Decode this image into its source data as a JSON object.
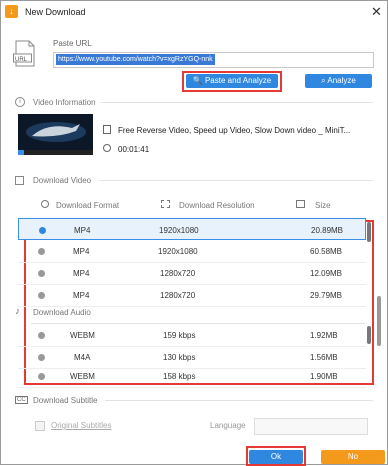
{
  "window": {
    "title": "New Download",
    "app_icon_glyph": "↓"
  },
  "paste": {
    "label": "Paste URL",
    "url_icon_text": "URL",
    "url_value": "https://www.youtube.com/watch?v=xgRzYGQ-nnk",
    "paste_analyze_label": "Paste and Analyze",
    "analyze_label": "Analyze"
  },
  "video_info": {
    "section_title": "Video Information",
    "title": "Free Reverse Video, Speed up Video, Slow Down video _ MiniT...",
    "duration": "00:01:41"
  },
  "download_video": {
    "section_title": "Download Video",
    "col_format": "Download Format",
    "col_resolution": "Download Resolution",
    "col_size": "Size",
    "rows": [
      {
        "format": "MP4",
        "resolution": "1920x1080",
        "size": "20.89MB",
        "selected": true
      },
      {
        "format": "MP4",
        "resolution": "1920x1080",
        "size": "60.58MB",
        "selected": false
      },
      {
        "format": "MP4",
        "resolution": "1280x720",
        "size": "12.09MB",
        "selected": false
      },
      {
        "format": "MP4",
        "resolution": "1280x720",
        "size": "29.79MB",
        "selected": false
      }
    ]
  },
  "download_audio": {
    "section_title": "Download Audio",
    "rows": [
      {
        "format": "WEBM",
        "bitrate": "159 kbps",
        "size": "1.92MB"
      },
      {
        "format": "M4A",
        "bitrate": "130 kbps",
        "size": "1.56MB"
      },
      {
        "format": "WEBM",
        "bitrate": "158 kbps",
        "size": "1.90MB"
      }
    ]
  },
  "download_subtitle": {
    "section_title": "Download Subtitle",
    "cc_text": "CC",
    "original_label": "Original Subtitles",
    "language_label": "Language"
  },
  "footer": {
    "ok_label": "Ok",
    "no_label": "No"
  },
  "colors": {
    "accent": "#2f87e0",
    "orange": "#f39a1d",
    "highlight": "#e53935"
  }
}
